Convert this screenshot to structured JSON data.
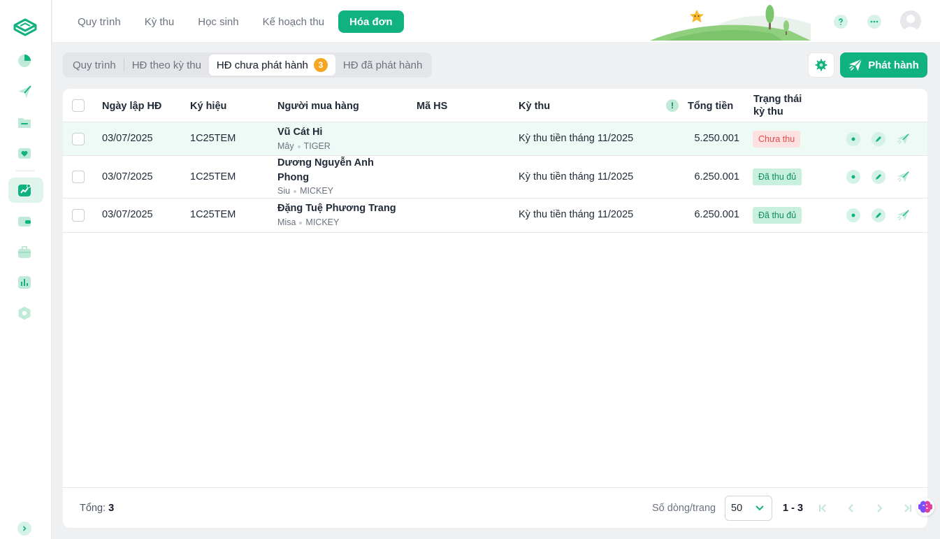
{
  "colors": {
    "accent": "#10b27f",
    "badge": "#f6a623",
    "unpaid": "#e24b4b",
    "paid": "#0f8c60"
  },
  "sidebar": {
    "items": [
      {
        "icon": "pie-chart-icon"
      },
      {
        "icon": "send-icon"
      },
      {
        "icon": "folder-icon"
      },
      {
        "icon": "heart-box-icon"
      },
      {
        "icon": "chart-trend-icon",
        "active": true
      },
      {
        "icon": "wallet-icon"
      },
      {
        "icon": "briefcase-icon"
      },
      {
        "icon": "bar-chart-icon"
      },
      {
        "icon": "settings-hex-icon"
      }
    ]
  },
  "topnav": {
    "items": [
      "Quy trình",
      "Kỳ thu",
      "Học sinh",
      "Kế hoạch thu",
      "Hóa đơn"
    ],
    "active_index": 4
  },
  "subtabs": {
    "items": [
      "Quy trình",
      "HĐ theo kỳ thu",
      "HĐ chưa phát hành",
      "HĐ đã phát hành"
    ],
    "active_index": 2,
    "badge": "3"
  },
  "toolbar": {
    "publish_label": "Phát hành"
  },
  "table": {
    "headers": {
      "date": "Ngày lập HĐ",
      "symbol": "Ký hiệu",
      "buyer": "Người mua hàng",
      "student_code": "Mã HS",
      "period": "Kỳ thu",
      "total": "Tổng tiền",
      "status": "Trạng thái kỳ thu"
    },
    "warning_glyph": "!",
    "rows": [
      {
        "date": "03/07/2025",
        "symbol": "1C25TEM",
        "buyer": "Vũ Cát Hi",
        "nickname": "Mây",
        "class": "TIGER",
        "student_code": "",
        "period": "Kỳ thu tiền tháng 11/2025",
        "total": "5.250.001",
        "status": "Chưa thu"
      },
      {
        "date": "03/07/2025",
        "symbol": "1C25TEM",
        "buyer": "Dương Nguyễn Anh Phong",
        "nickname": "Siu",
        "class": "MICKEY",
        "student_code": "",
        "period": "Kỳ thu tiền tháng 11/2025",
        "total": "6.250.001",
        "status": "Đã thu đủ"
      },
      {
        "date": "03/07/2025",
        "symbol": "1C25TEM",
        "buyer": "Đặng Tuệ Phương Trang",
        "nickname": "Misa",
        "class": "MICKEY",
        "student_code": "",
        "period": "Kỳ thu tiền tháng 11/2025",
        "total": "6.250.001",
        "status": "Đã thu đủ"
      }
    ]
  },
  "footer": {
    "total_label": "Tổng:",
    "total_value": "3",
    "per_page_label": "Số dòng/trang",
    "per_page_value": "50",
    "range": "1 - 3"
  }
}
